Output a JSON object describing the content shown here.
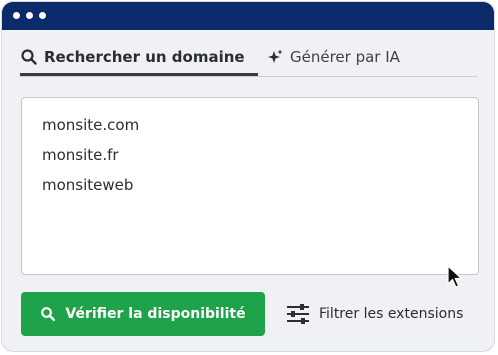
{
  "window": {
    "titlebar_color": "#0c2b6b",
    "dots": [
      "dot",
      "dot",
      "dot"
    ]
  },
  "tabs": [
    {
      "label": "Rechercher un domaine",
      "icon": "search-icon",
      "active": true
    },
    {
      "label": "Générer par IA",
      "icon": "sparkle-icon",
      "active": false
    }
  ],
  "domains_input": {
    "lines": [
      "monsite.com",
      "monsite.fr",
      "monsiteweb"
    ]
  },
  "verify_button": {
    "label": "Vérifier la disponibilité",
    "icon": "search-icon",
    "color": "#1ea24a"
  },
  "filter_button": {
    "label": "Filtrer les extensions",
    "icon": "sliders-icon"
  },
  "cursor": {
    "icon": "mouse-pointer-icon"
  }
}
